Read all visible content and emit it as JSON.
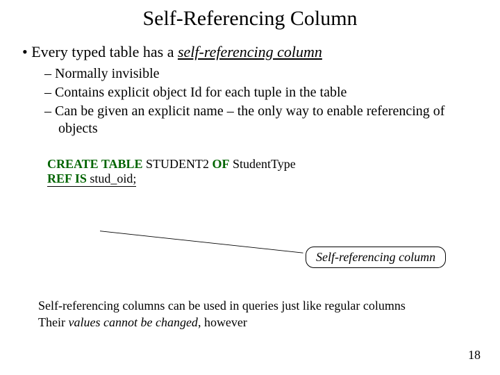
{
  "title": "Self-Referencing Column",
  "bullet1_prefix": "Every typed table has a ",
  "bullet1_term": "self-referencing column",
  "sub": {
    "a": "Normally invisible",
    "b": "Contains explicit object Id for each tuple in the table",
    "c": "Can be given an explicit name – the only way to enable referencing of objects"
  },
  "code": {
    "line1_kw1": "CREATE  TABLE",
    "line1_ident": "   STUDENT2  ",
    "line1_kw2": "OF",
    "line1_type": "  StudentType",
    "line2_kw": "REF IS",
    "line2_ident": "  stud_oid;"
  },
  "callout": "Self-referencing column",
  "note1_a": "Self-referencing columns can be used in queries just like regular columns",
  "note2_a": "Their ",
  "note2_b": "values cannot be changed",
  "note2_c": ", however",
  "pagenum": "18"
}
